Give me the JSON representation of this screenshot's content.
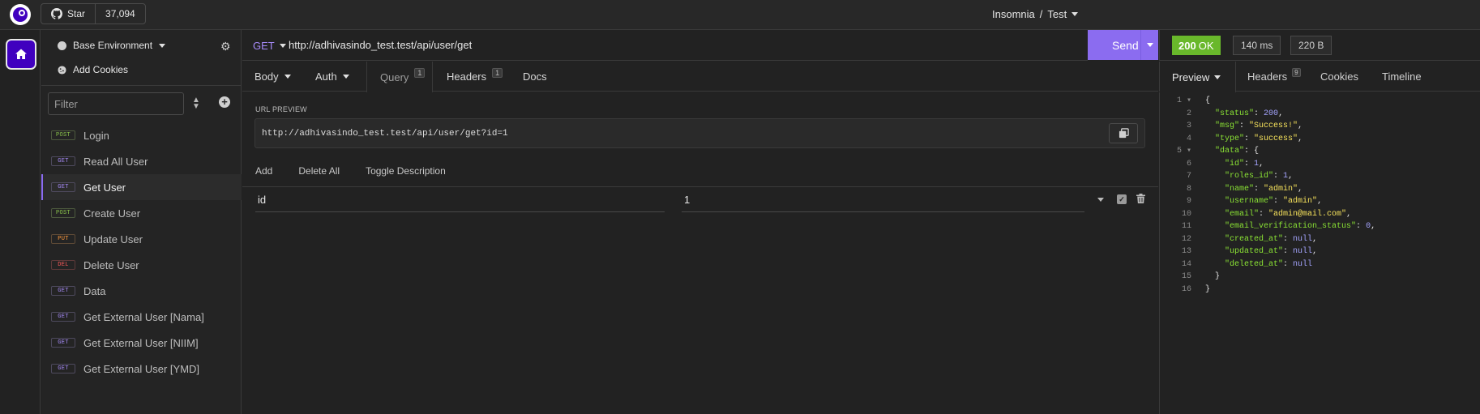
{
  "app": {
    "github": {
      "star_label": "Star",
      "star_count": "37,094"
    },
    "breadcrumb": {
      "app_name": "Insomnia",
      "separator": "/",
      "workspace": "Test"
    }
  },
  "sidebar": {
    "environment": "Base Environment",
    "cookies": "Add Cookies",
    "filter_placeholder": "Filter",
    "requests": [
      {
        "method": "POST",
        "name": "Login",
        "active": false
      },
      {
        "method": "GET",
        "name": "Read All User",
        "active": false
      },
      {
        "method": "GET",
        "name": "Get User",
        "active": true
      },
      {
        "method": "POST",
        "name": "Create User",
        "active": false
      },
      {
        "method": "PUT",
        "name": "Update User",
        "active": false
      },
      {
        "method": "DEL",
        "name": "Delete User",
        "active": false
      },
      {
        "method": "GET",
        "name": "Data",
        "active": false
      },
      {
        "method": "GET",
        "name": "Get External User [Nama]",
        "active": false
      },
      {
        "method": "GET",
        "name": "Get External User [NIIM]",
        "active": false
      },
      {
        "method": "GET",
        "name": "Get External User [YMD]",
        "active": false
      }
    ]
  },
  "request": {
    "method": "GET",
    "url": "http://adhivasindo_test.test/api/user/get",
    "send_label": "Send",
    "tabs": {
      "body": "Body",
      "auth": "Auth",
      "query": "Query",
      "query_count": "1",
      "headers": "Headers",
      "headers_count": "1",
      "docs": "Docs"
    },
    "url_preview_label": "URL PREVIEW",
    "url_preview": "http://adhivasindo_test.test/api/user/get?id=1",
    "actions": {
      "add": "Add",
      "delete_all": "Delete All",
      "toggle": "Toggle Description"
    },
    "params": [
      {
        "name": "id",
        "value": "1"
      }
    ]
  },
  "response": {
    "status_code": "200",
    "status_text": "OK",
    "time": "140 ms",
    "size": "220 B",
    "tabs": {
      "preview": "Preview",
      "headers": "Headers",
      "headers_count": "9",
      "cookies": "Cookies",
      "timeline": "Timeline"
    },
    "body_lines": [
      [
        [
          "p",
          "{"
        ]
      ],
      [
        [
          "p",
          "  "
        ],
        [
          "k",
          "\"status\""
        ],
        [
          "p",
          ": "
        ],
        [
          "n",
          "200"
        ],
        [
          "p",
          ","
        ]
      ],
      [
        [
          "p",
          "  "
        ],
        [
          "k",
          "\"msg\""
        ],
        [
          "p",
          ": "
        ],
        [
          "s",
          "\"Success!\""
        ],
        [
          "p",
          ","
        ]
      ],
      [
        [
          "p",
          "  "
        ],
        [
          "k",
          "\"type\""
        ],
        [
          "p",
          ": "
        ],
        [
          "s",
          "\"success\""
        ],
        [
          "p",
          ","
        ]
      ],
      [
        [
          "p",
          "  "
        ],
        [
          "k",
          "\"data\""
        ],
        [
          "p",
          ": {"
        ]
      ],
      [
        [
          "p",
          "    "
        ],
        [
          "k",
          "\"id\""
        ],
        [
          "p",
          ": "
        ],
        [
          "n",
          "1"
        ],
        [
          "p",
          ","
        ]
      ],
      [
        [
          "p",
          "    "
        ],
        [
          "k",
          "\"roles_id\""
        ],
        [
          "p",
          ": "
        ],
        [
          "n",
          "1"
        ],
        [
          "p",
          ","
        ]
      ],
      [
        [
          "p",
          "    "
        ],
        [
          "k",
          "\"name\""
        ],
        [
          "p",
          ": "
        ],
        [
          "s",
          "\"admin\""
        ],
        [
          "p",
          ","
        ]
      ],
      [
        [
          "p",
          "    "
        ],
        [
          "k",
          "\"username\""
        ],
        [
          "p",
          ": "
        ],
        [
          "s",
          "\"admin\""
        ],
        [
          "p",
          ","
        ]
      ],
      [
        [
          "p",
          "    "
        ],
        [
          "k",
          "\"email\""
        ],
        [
          "p",
          ": "
        ],
        [
          "s",
          "\"admin@mail.com\""
        ],
        [
          "p",
          ","
        ]
      ],
      [
        [
          "p",
          "    "
        ],
        [
          "k",
          "\"email_verification_status\""
        ],
        [
          "p",
          ": "
        ],
        [
          "n",
          "0"
        ],
        [
          "p",
          ","
        ]
      ],
      [
        [
          "p",
          "    "
        ],
        [
          "k",
          "\"created_at\""
        ],
        [
          "p",
          ": "
        ],
        [
          "n",
          "null"
        ],
        [
          "p",
          ","
        ]
      ],
      [
        [
          "p",
          "    "
        ],
        [
          "k",
          "\"updated_at\""
        ],
        [
          "p",
          ": "
        ],
        [
          "n",
          "null"
        ],
        [
          "p",
          ","
        ]
      ],
      [
        [
          "p",
          "    "
        ],
        [
          "k",
          "\"deleted_at\""
        ],
        [
          "p",
          ": "
        ],
        [
          "n",
          "null"
        ]
      ],
      [
        [
          "p",
          "  }"
        ]
      ],
      [
        [
          "p",
          "}"
        ]
      ]
    ]
  },
  "colors": {
    "accent": "#8b6cf0",
    "brand": "#4000bf",
    "ok": "#69b82b",
    "get": "#a78bfa",
    "post": "#8ac44b",
    "put": "#ff9a3c",
    "del": "#ff5a5a"
  },
  "icons": {
    "logo": "insomnia-logo-icon",
    "github": "github-icon",
    "home": "home-icon",
    "settings": "gear-icon",
    "cookie": "cookie-icon",
    "sort": "sort-icon",
    "add": "plus-circle-icon",
    "copy": "copy-icon",
    "checkbox": "checkbox-icon",
    "trash": "trash-icon"
  }
}
